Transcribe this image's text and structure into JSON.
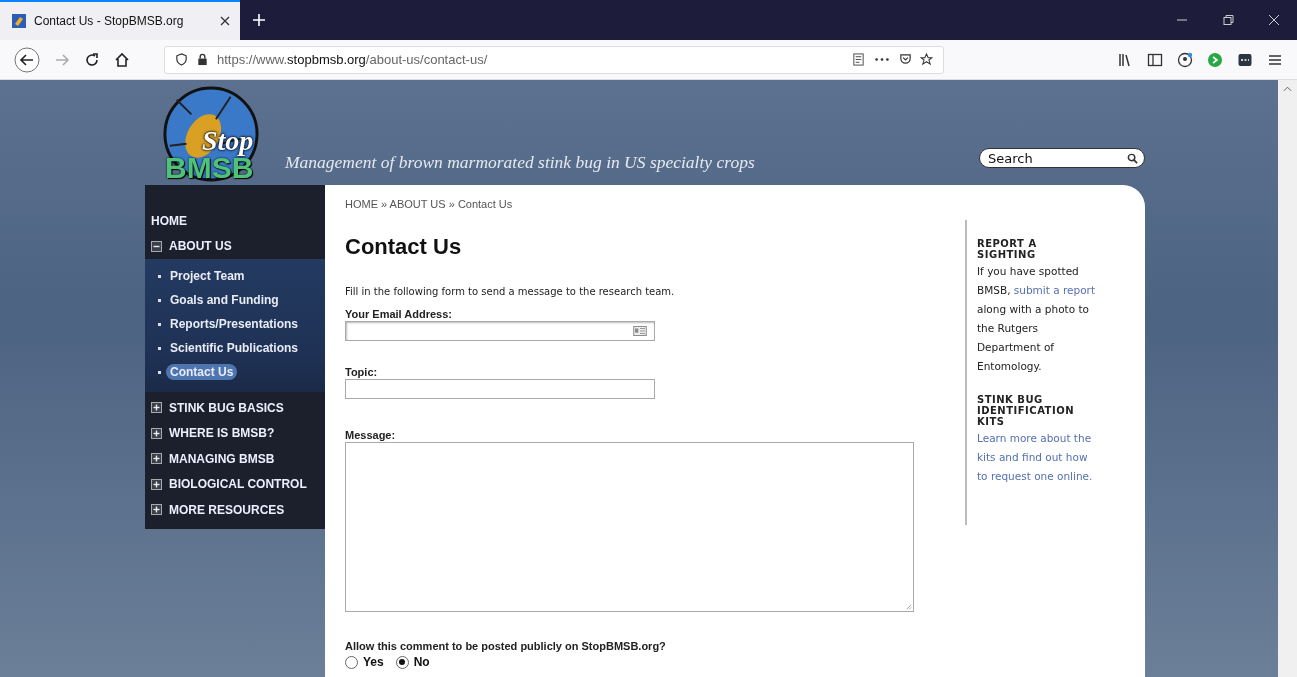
{
  "browser": {
    "tab": {
      "title": "Contact Us - StopBMSB.org",
      "selected": true
    },
    "url": "https://www.**stopbmsb.org**/about-us/contact-us/"
  },
  "site": {
    "logo_top": "Stop",
    "logo_bottom": "BMSB",
    "tagline": "Management of brown marmorated stink bug in US specialty crops",
    "search": {
      "placeholder": "Search"
    }
  },
  "nav": [
    {
      "label": "HOME",
      "kind": "link"
    },
    {
      "label": "ABOUT US",
      "kind": "section",
      "expanded": true,
      "children": [
        {
          "label": "Project Team",
          "selected": false
        },
        {
          "label": "Goals and Funding",
          "selected": false
        },
        {
          "label": "Reports/Presentations",
          "selected": false
        },
        {
          "label": "Scientific Publications",
          "selected": false
        },
        {
          "label": "Contact Us",
          "selected": true
        }
      ]
    },
    {
      "label": "STINK BUG BASICS",
      "kind": "section",
      "expanded": false
    },
    {
      "label": "WHERE IS BMSB?",
      "kind": "section",
      "expanded": false
    },
    {
      "label": "MANAGING BMSB",
      "kind": "section",
      "expanded": false
    },
    {
      "label": "BIOLOGICAL CONTROL",
      "kind": "section",
      "expanded": false
    },
    {
      "label": "MORE RESOURCES",
      "kind": "section",
      "expanded": false
    }
  ],
  "breadcrumb": "HOME » ABOUT US » Contact Us",
  "page_title": "Contact Us",
  "intro": "Fill in the following form to send a message to the research team.",
  "form": {
    "fields": [
      {
        "label": "Your Email Address:",
        "kind": "email"
      },
      {
        "label": "Topic:",
        "kind": "text"
      },
      {
        "label": "Message:",
        "kind": "textarea"
      }
    ],
    "question": "Allow this comment to be posted publicly on StopBMSB.org?",
    "options": [
      {
        "label": "Yes",
        "selected": false
      },
      {
        "label": "No",
        "selected": true
      }
    ]
  },
  "aside": [
    {
      "heading": "REPORT A SIGHTING",
      "text_before": "If you have spotted BMSB,",
      "link": "submit a report",
      "text_after": "along with a photo to the Rutgers Department of Entomology."
    },
    {
      "heading": "STINK BUG IDENTIFICATION KITS",
      "link": "Learn more about the kits and find out how to request one online."
    }
  ]
}
